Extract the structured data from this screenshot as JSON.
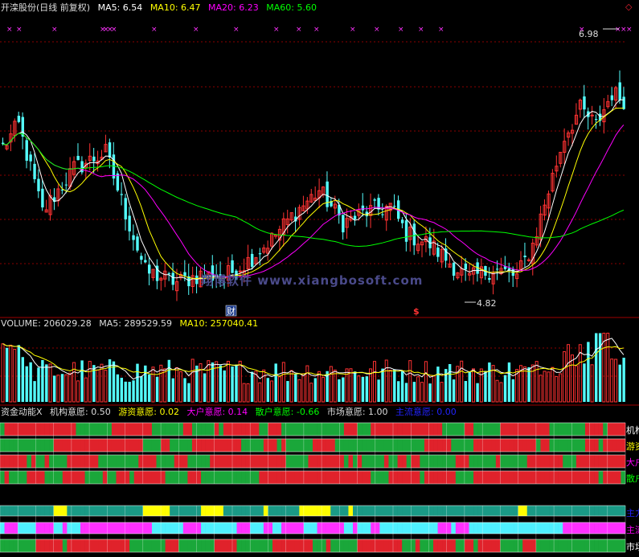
{
  "price_header": {
    "name": "开滦股份(日线 前复权)",
    "ma5": "MA5: 6.54",
    "ma10": "MA10: 6.47",
    "ma20": "MA20: 6.23",
    "ma60": "MA60: 5.60"
  },
  "volume_header": {
    "volume": "VOLUME: 206029.28",
    "ma5": "MA5: 289529.59",
    "ma10": "MA10: 257040.41"
  },
  "indicator_header": {
    "name": "资金动能X",
    "jigou": "机构意愿: 0.50",
    "youzi": "游资意愿: 0.02",
    "dahu": "大户意愿: 0.14",
    "sanhu": "散户意愿: -0.66",
    "shichang": "市场意愿: 1.00",
    "zhuliu": "主流意愿: 0.00"
  },
  "annotations": {
    "high_label": "6.98",
    "low_label": "4.82",
    "cai_marker": "财",
    "s_marker": "$",
    "watermark": "翔博软件 www.xiangbosoft.com",
    "corner_marker": "◇"
  },
  "right_labels": {
    "r1": "机构",
    "r2": "游资",
    "r3": "大户",
    "r4": "散户",
    "r5": "主力",
    "r6": "主流",
    "r7": "市场"
  },
  "colors": {
    "up": "#ff3232",
    "down": "#54ffff",
    "ma5": "#ffffff",
    "ma10": "#ffff00",
    "ma20": "#ff00ff",
    "ma60": "#00ff00",
    "grid": "#8b0000",
    "band_green": "#1aa73a",
    "band_red": "#e0222b",
    "band_teal": "#1a9a86",
    "band_yellow": "#ffff00",
    "band_cyan": "#4ff0ff",
    "band_magenta": "#ff30ff"
  },
  "chart_data": {
    "type": "candlestick",
    "series": [
      {
        "name": "MA5",
        "value": 6.54
      },
      {
        "name": "MA10",
        "value": 6.47
      },
      {
        "name": "MA20",
        "value": 6.23
      },
      {
        "name": "MA60",
        "value": 5.6
      }
    ],
    "high": 6.98,
    "low": 4.82,
    "volume": 206029.28,
    "volume_ma5": 289529.59,
    "volume_ma10": 257040.41,
    "indicator": {
      "机构意愿": 0.5,
      "游资意愿": 0.02,
      "大户意愿": 0.14,
      "散户意愿": -0.66,
      "市场意愿": 1.0,
      "主流意愿": 0.0
    }
  }
}
